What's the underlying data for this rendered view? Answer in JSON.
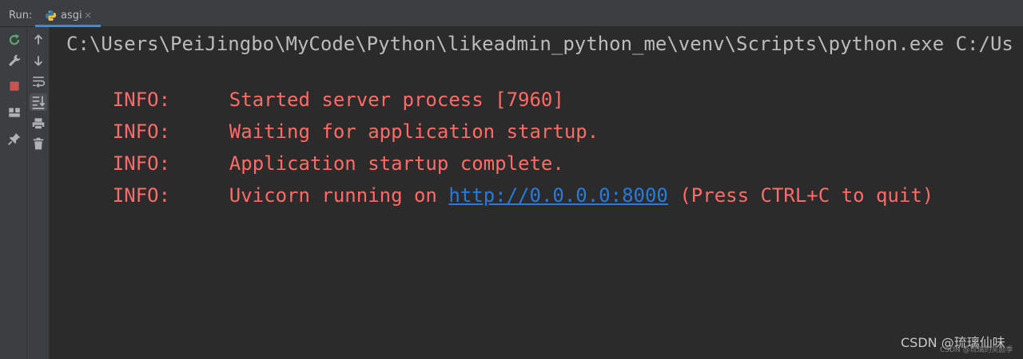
{
  "run_panel": {
    "label": "Run:",
    "tab": {
      "label": "asgi",
      "icon": "python-icon",
      "close": "×"
    }
  },
  "toolbar": {
    "left": [
      "rerun-icon",
      "wrench-icon",
      "stop-icon",
      "layout-icon",
      "pin-icon"
    ],
    "right": [
      "arrow-up-icon",
      "arrow-down-icon",
      "soft-wrap-icon",
      "scroll-to-end-icon",
      "print-icon",
      "trash-icon"
    ]
  },
  "console": {
    "command": "C:\\Users\\PeiJingbo\\MyCode\\Python\\likeadmin_python_me\\venv\\Scripts\\python.exe C:/Us",
    "logs": [
      {
        "level": "INFO:",
        "message": "Started server process [7960]"
      },
      {
        "level": "INFO:",
        "message": "Waiting for application startup."
      },
      {
        "level": "INFO:",
        "message": "Application startup complete."
      },
      {
        "level": "INFO:",
        "message_before": "Uvicorn running on ",
        "link": "http://0.0.0.0:8000",
        "message_after": " (Press CTRL+C to quit)"
      }
    ]
  },
  "watermark": {
    "main": "CSDN @琉璃仙味",
    "sub": "CSDN @琉璃的奖励季"
  },
  "colors": {
    "background": "#2b2b2b",
    "toolbar": "#3c3f41",
    "error_text": "#ff6b68",
    "command_text": "#bbbbbb",
    "link": "#287bde",
    "tab_underline": "#4a88c7",
    "stop": "#c75450",
    "rerun": "#59a869"
  }
}
